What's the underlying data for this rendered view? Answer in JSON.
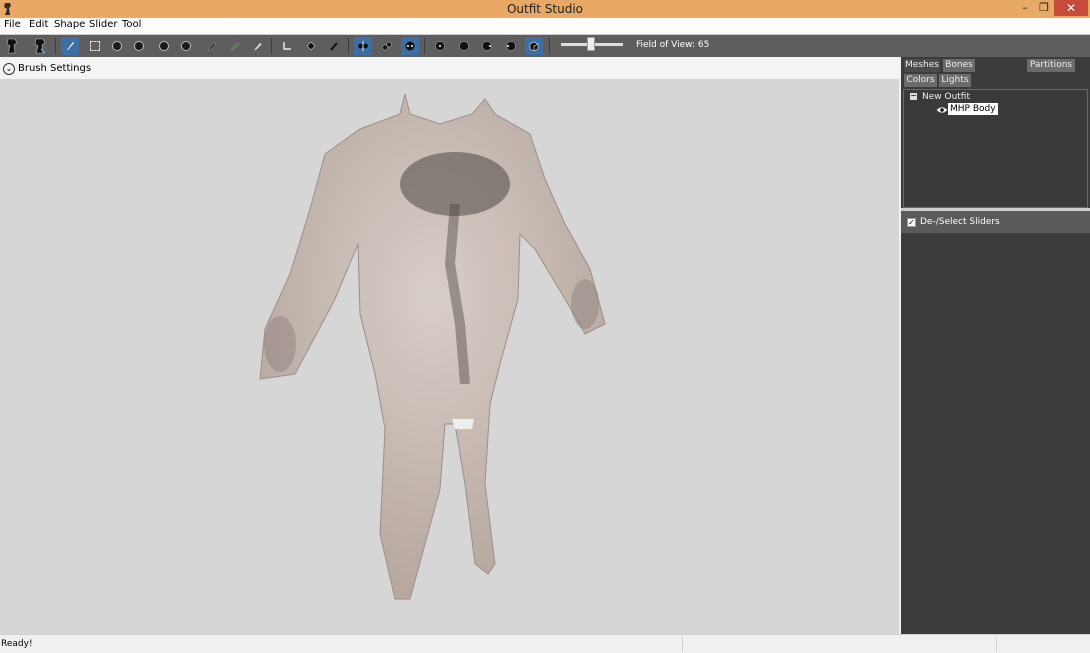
{
  "window": {
    "title": "Outfit Studio",
    "min": "–",
    "max": "❐",
    "close": "✕"
  },
  "menu": [
    "File",
    "Edit",
    "Shape",
    "Slider",
    "Tool"
  ],
  "toolbar": {
    "field_of_view_label": "Field of View: 65",
    "field_of_view": 65,
    "accent_color": "#3d6fa6",
    "buttons": [
      "load-outfit-icon",
      "save-outfit-icon",
      "select-brush-icon",
      "mask-brush-icon",
      "inflate-brush-icon",
      "deflate-brush-icon",
      "move-brush-icon",
      "smooth-brush-icon",
      "color-brush-icon",
      "alpha-brush-icon",
      "weight-brush-icon",
      "transform-icon",
      "pivot-icon",
      "vertex-edit-icon",
      "x-mirror-icon",
      "connected-only-icon",
      "global-brush-icon",
      "front-view-icon",
      "back-view-icon",
      "left-view-icon",
      "right-view-icon",
      "perspective-icon"
    ]
  },
  "viewport": {
    "brush_settings_label": "Brush Settings",
    "background": "#d6d6d6"
  },
  "right_panel": {
    "tabs": [
      "Meshes",
      "Bones",
      "Colors",
      "Lights"
    ],
    "partitions_label": "Partitions",
    "tree": {
      "root": "New Outfit",
      "children": [
        "MHP Body"
      ]
    },
    "sliders_label": "De-/Select Sliders"
  },
  "status": {
    "text": "Ready!"
  }
}
